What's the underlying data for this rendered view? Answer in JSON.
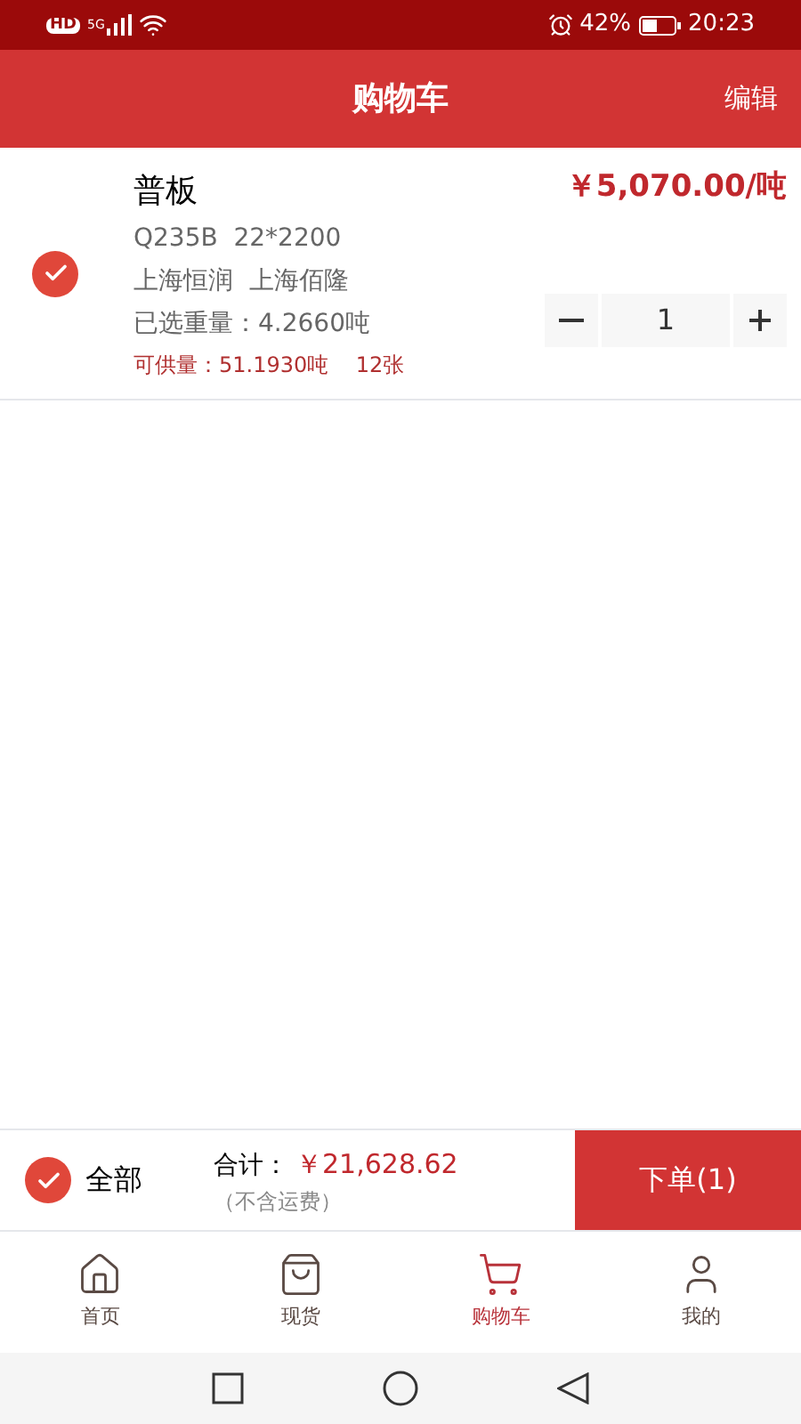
{
  "status_bar": {
    "hd": "HD",
    "network": "5G",
    "battery": "42%",
    "time": "20:23"
  },
  "header": {
    "title": "购物车",
    "action": "编辑"
  },
  "items": [
    {
      "name": "普板",
      "spec": "Q235B  22*2200",
      "vendor": "上海恒润  上海佰隆",
      "weight": "已选重量：4.2660吨",
      "supply": "可供量：51.1930吨    12张",
      "price": "￥5,070.00/吨",
      "quantity": "1",
      "checked": true
    }
  ],
  "footer": {
    "select_all": {
      "label": "全部",
      "checked": true
    },
    "total_label": "合计：",
    "total": "￥21,628.62",
    "note": "（不含运费）",
    "submit": "下单(1)"
  },
  "tabs": [
    {
      "label": "首页",
      "kind": "home",
      "selected": false
    },
    {
      "label": "现货",
      "kind": "bag",
      "selected": false
    },
    {
      "label": "购物车",
      "kind": "cart",
      "selected": true
    },
    {
      "label": "我的",
      "kind": "user",
      "selected": false
    }
  ]
}
